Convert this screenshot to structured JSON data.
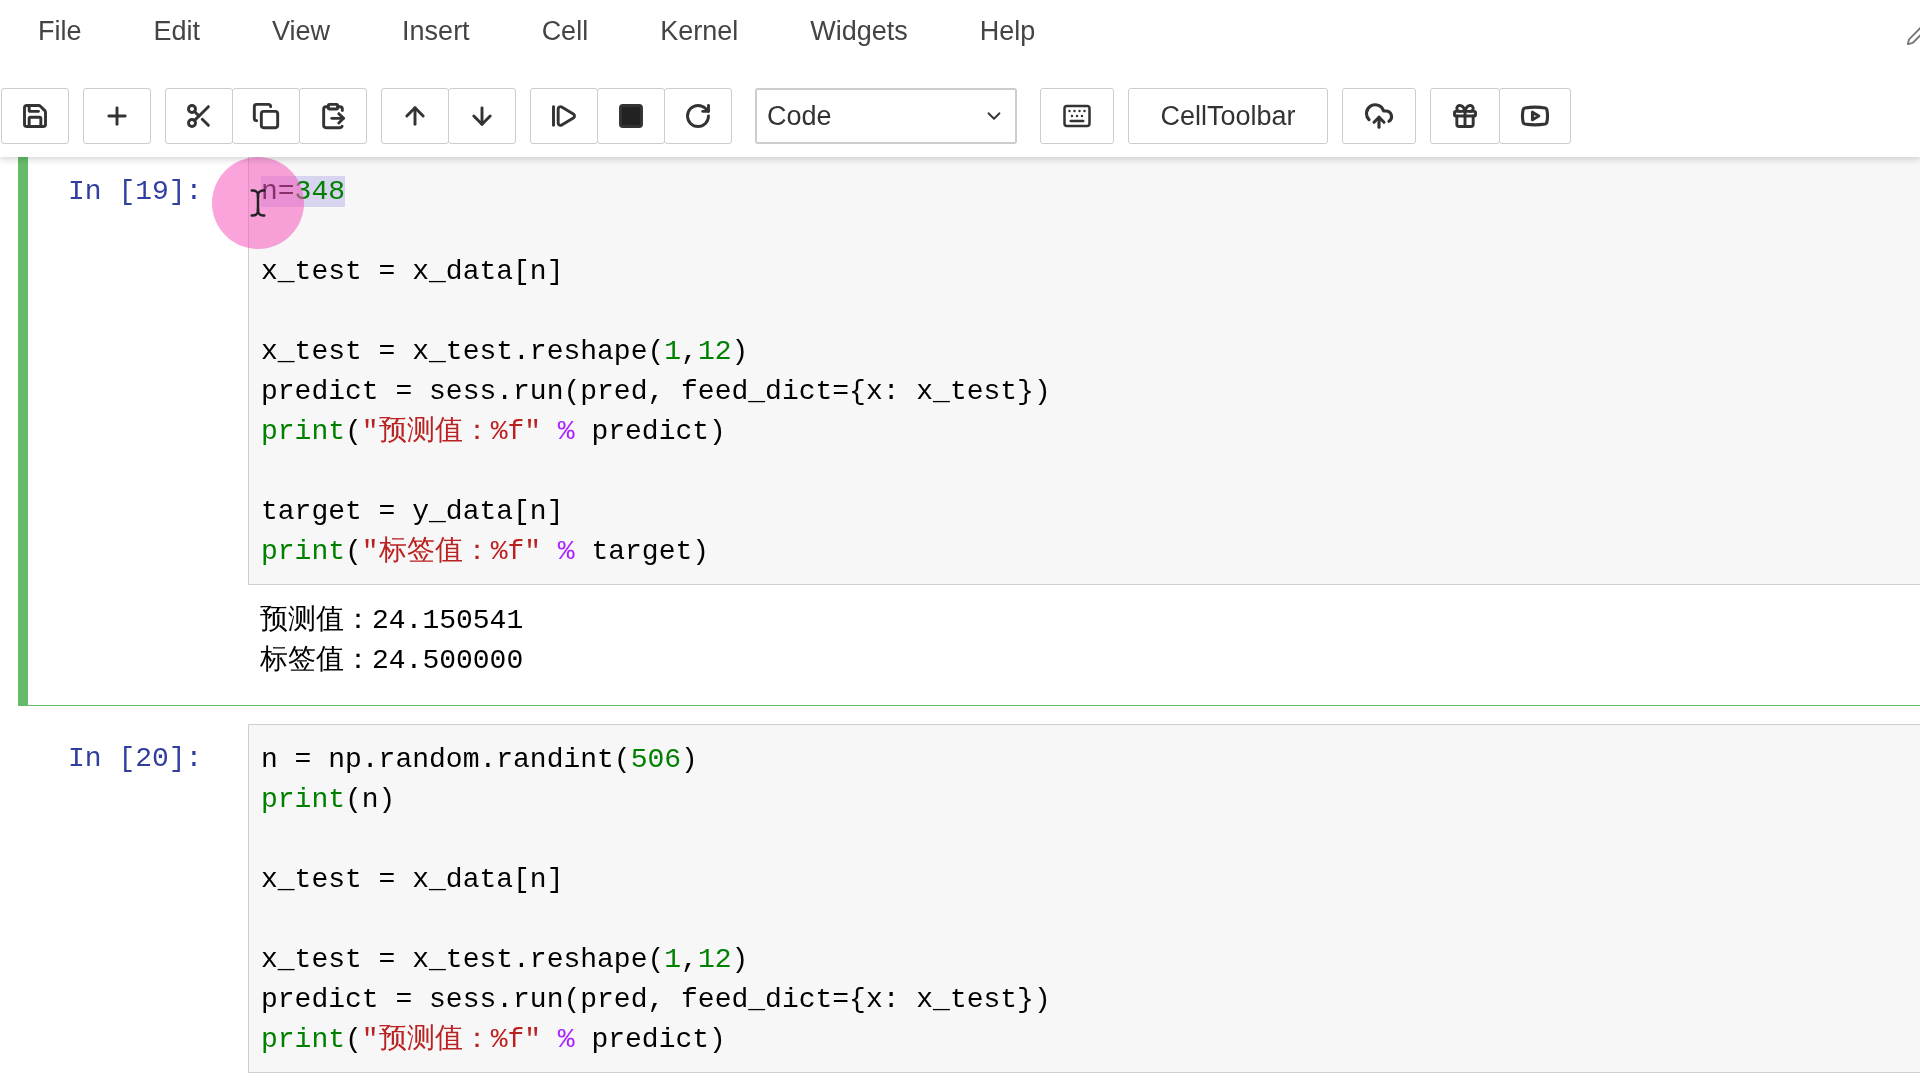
{
  "menu": [
    "File",
    "Edit",
    "View",
    "Insert",
    "Cell",
    "Kernel",
    "Widgets",
    "Help"
  ],
  "cell_type_select": "Code",
  "celltoolbar_button": "CellToolbar",
  "cells": [
    {
      "prompt": "In [19]:",
      "selected": true,
      "cursor_shown": true,
      "input": [
        {
          "kind": "code",
          "selected": true,
          "tokens": [
            {
              "text": "n=",
              "kind": "plain"
            },
            {
              "text": "348",
              "kind": "number"
            }
          ]
        },
        {
          "kind": "blank"
        },
        {
          "kind": "code",
          "selected": false,
          "tokens": [
            {
              "text": "x_test = x_data[n]",
              "kind": "plain"
            }
          ]
        },
        {
          "kind": "blank"
        },
        {
          "kind": "code",
          "selected": false,
          "tokens": [
            {
              "text": "x_test = x_test.reshape(",
              "kind": "plain"
            },
            {
              "text": "1",
              "kind": "number"
            },
            {
              "text": ",",
              "kind": "plain"
            },
            {
              "text": "12",
              "kind": "number"
            },
            {
              "text": ")",
              "kind": "plain"
            }
          ]
        },
        {
          "kind": "code",
          "selected": false,
          "tokens": [
            {
              "text": "predict = sess.run(pred, feed_dict={x: x_test})",
              "kind": "plain"
            }
          ]
        },
        {
          "kind": "code",
          "selected": false,
          "tokens": [
            {
              "text": "print",
              "kind": "builtin"
            },
            {
              "text": "(",
              "kind": "plain"
            },
            {
              "text": "\"预测值：%f\"",
              "kind": "string"
            },
            {
              "text": " %",
              "kind": "operator"
            },
            {
              "text": " predict)",
              "kind": "plain"
            }
          ]
        },
        {
          "kind": "blank"
        },
        {
          "kind": "code",
          "selected": false,
          "tokens": [
            {
              "text": "target = y_data[n]",
              "kind": "plain"
            }
          ]
        },
        {
          "kind": "code",
          "selected": false,
          "tokens": [
            {
              "text": "print",
              "kind": "builtin"
            },
            {
              "text": "(",
              "kind": "plain"
            },
            {
              "text": "\"标签值：%f\"",
              "kind": "string"
            },
            {
              "text": " %",
              "kind": "operator"
            },
            {
              "text": " target)",
              "kind": "plain"
            }
          ]
        }
      ],
      "output": [
        "预测值：24.150541",
        "标签值：24.500000"
      ]
    },
    {
      "prompt": "In [20]:",
      "selected": false,
      "input": [
        {
          "kind": "code",
          "selected": false,
          "tokens": [
            {
              "text": "n = np.random.randint(",
              "kind": "plain"
            },
            {
              "text": "506",
              "kind": "number"
            },
            {
              "text": ")",
              "kind": "plain"
            }
          ]
        },
        {
          "kind": "code",
          "selected": false,
          "tokens": [
            {
              "text": "print",
              "kind": "builtin"
            },
            {
              "text": "(n)",
              "kind": "plain"
            }
          ]
        },
        {
          "kind": "blank"
        },
        {
          "kind": "code",
          "selected": false,
          "tokens": [
            {
              "text": "x_test = x_data[n]",
              "kind": "plain"
            }
          ]
        },
        {
          "kind": "blank"
        },
        {
          "kind": "code",
          "selected": false,
          "tokens": [
            {
              "text": "x_test = x_test.reshape(",
              "kind": "plain"
            },
            {
              "text": "1",
              "kind": "number"
            },
            {
              "text": ",",
              "kind": "plain"
            },
            {
              "text": "12",
              "kind": "number"
            },
            {
              "text": ")",
              "kind": "plain"
            }
          ]
        },
        {
          "kind": "code",
          "selected": false,
          "tokens": [
            {
              "text": "predict = sess.run(pred, feed_dict={x: x_test})",
              "kind": "plain"
            }
          ]
        },
        {
          "kind": "code",
          "selected": false,
          "tokens": [
            {
              "text": "print",
              "kind": "builtin"
            },
            {
              "text": "(",
              "kind": "plain"
            },
            {
              "text": "\"预测值：%f\"",
              "kind": "string"
            },
            {
              "text": " %",
              "kind": "operator"
            },
            {
              "text": " predict)",
              "kind": "plain"
            }
          ]
        }
      ]
    }
  ]
}
